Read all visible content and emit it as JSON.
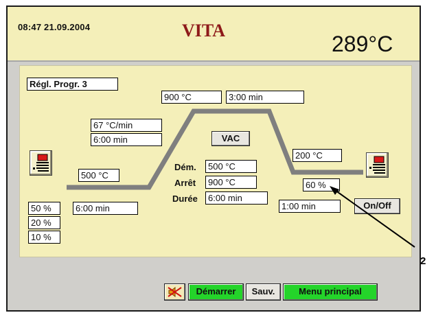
{
  "header": {
    "clock": "08:47  21.09.2004",
    "brand": "VITA",
    "temperature": "289°C"
  },
  "program": {
    "title": "Régl. Progr. 3",
    "hold_temp": "900 °C",
    "hold_time": "3:00 min",
    "heat_rate": "67 °C/min",
    "heat_time": "6:00 min",
    "start_temp": "500 °C",
    "dry_time": "6:00 min",
    "cool_temp": "200 °C",
    "cool_percent": "60 %",
    "cool_time": "1:00 min",
    "lift_percents": [
      "50 %",
      "20 %",
      "10 %"
    ]
  },
  "vacuum": {
    "button": "VAC",
    "start_label": "Dém.",
    "start_value": "500 °C",
    "stop_label": "Arrêt",
    "stop_value": "900 °C",
    "duration_label": "Durée",
    "duration_value": "6:00 min"
  },
  "controls": {
    "on_off": "On/Off",
    "start": "Démarrer",
    "save": "Sauv.",
    "main_menu": "Menu principal"
  },
  "callout": "2",
  "colors": {
    "panel": "#f4efb9",
    "screen": "#d0cfcb",
    "brand": "#8e1a1a",
    "green_button": "#24d42a",
    "curve": "#7f7f7f"
  }
}
